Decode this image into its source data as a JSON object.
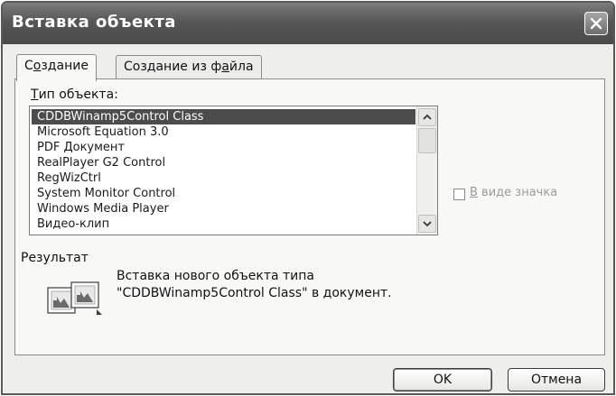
{
  "window": {
    "title": "Вставка объекта"
  },
  "tabs": [
    {
      "label": "Создание",
      "accesskey": "о",
      "before": "С",
      "after": "здание",
      "active": true
    },
    {
      "label": "Создание из файла",
      "before": "Создание из ф",
      "accesskey": "а",
      "after": "йла",
      "active": false
    }
  ],
  "object_type": {
    "label": "Тип объекта:",
    "accesskey": "Т",
    "label_rest": "ип объекта:",
    "items": [
      "CDDBWinamp5Control Class",
      "Microsoft Equation 3.0",
      "PDF Документ",
      "RealPlayer G2 Control",
      "RegWizCtrl",
      "System Monitor Control",
      "Windows Media Player",
      "Видео-клип"
    ],
    "selected_index": 0
  },
  "display_as_icon": {
    "label": "В виде значка",
    "accesskey": "В",
    "label_rest": " виде значка",
    "checked": false
  },
  "result": {
    "heading": "Результат",
    "line1": "Вставка нового объекта типа",
    "line2": "\"CDDBWinamp5Control Class\" в документ."
  },
  "buttons": {
    "ok": "OK",
    "cancel": "Отмена"
  },
  "icons": {
    "close": "close-icon",
    "scroll_up": "chevron-up-icon",
    "scroll_down": "chevron-down-icon",
    "result": "insert-object-icon"
  }
}
